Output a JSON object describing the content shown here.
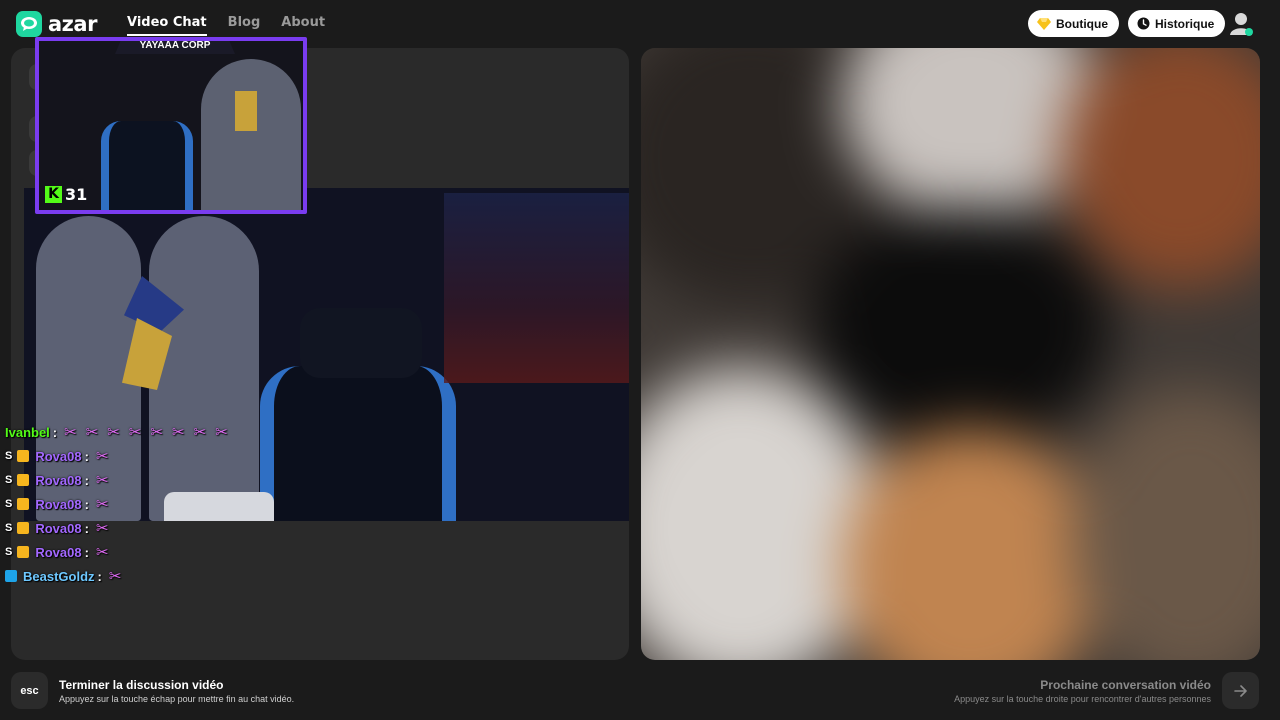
{
  "app": {
    "logo_text": "azar"
  },
  "nav": {
    "items": [
      {
        "label": "Video Chat",
        "active": true
      },
      {
        "label": "Blog",
        "active": false
      },
      {
        "label": "About",
        "active": false
      }
    ]
  },
  "header": {
    "shop_label": "Boutique",
    "shop_icon": "diamond-icon",
    "history_label": "Historique",
    "history_icon": "clock-icon",
    "avatar_icon": "user-avatar-icon"
  },
  "overlay": {
    "webcam_title": "YAYAAA CORP",
    "viewer_count": "31"
  },
  "chat": {
    "messages": [
      {
        "prefix": "",
        "user": "Ivanbel",
        "color": "green",
        "emotes": 8
      },
      {
        "prefix": "S",
        "user": "Rova08",
        "color": "purple",
        "emotes": 1
      },
      {
        "prefix": "S",
        "user": "Rova08",
        "color": "purple",
        "emotes": 1
      },
      {
        "prefix": "S",
        "user": "Rova08",
        "color": "purple",
        "emotes": 1
      },
      {
        "prefix": "S",
        "user": "Rova08",
        "color": "purple",
        "emotes": 1
      },
      {
        "prefix": "S",
        "user": "Rova08",
        "color": "purple",
        "emotes": 1
      },
      {
        "prefix": "",
        "user": "BeastGoldz",
        "color": "blue",
        "emotes": 1
      }
    ]
  },
  "footer": {
    "esc_key": "esc",
    "end_title": "Terminer la discussion vidéo",
    "end_subtitle": "Appuyez sur la touche échap pour mettre fin au chat vidéo.",
    "next_title": "Prochaine conversation vidéo",
    "next_subtitle": "Appuyez sur la touche droite pour rencontrer d'autres personnes",
    "next_icon": "arrow-right-icon"
  },
  "colors": {
    "accent": "#1fd7a0",
    "kick_green": "#53fc18",
    "frame_purple": "#7a3cf0",
    "background": "#1b1b1b"
  }
}
